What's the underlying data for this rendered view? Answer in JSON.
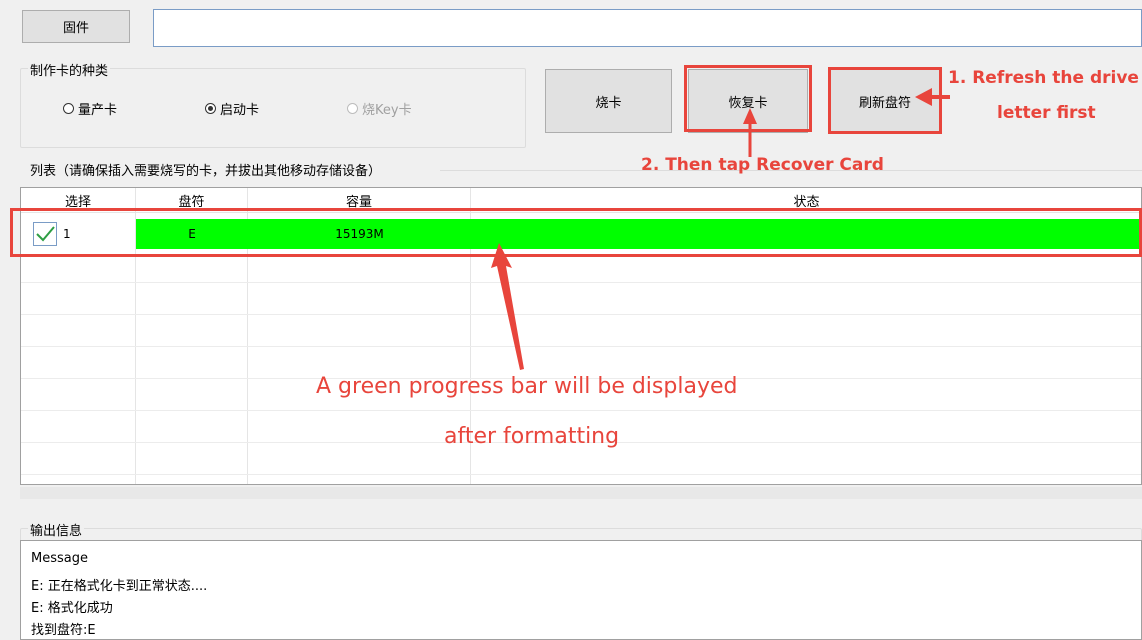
{
  "toolbar": {
    "firmware_label": "固件",
    "firmware_path": ""
  },
  "card_type": {
    "legend": "制作卡的种类",
    "options": [
      {
        "label": "量产卡",
        "selected": false,
        "disabled": false
      },
      {
        "label": "启动卡",
        "selected": true,
        "disabled": false
      },
      {
        "label": "烧Key卡",
        "selected": false,
        "disabled": true
      }
    ]
  },
  "actions": {
    "burn_label": "烧卡",
    "recover_label": "恢复卡",
    "refresh_label": "刷新盘符"
  },
  "list": {
    "legend": "列表（请确保插入需要烧写的卡，并拔出其他移动存储设备）",
    "columns": [
      "选择",
      "盘符",
      "容量",
      "状态"
    ],
    "rows": [
      {
        "index": "1",
        "checked": true,
        "drive": "E",
        "capacity": "15193M",
        "status": "",
        "progress": 1.0
      }
    ]
  },
  "output": {
    "legend": "输出信息",
    "lines": [
      "Message",
      "E: 正在格式化卡到正常状态....",
      "E: 格式化成功",
      "找到盘符:E"
    ]
  },
  "annotations": {
    "step1_line1": "1. Refresh the drive",
    "step1_line2": "letter first",
    "step2": "2. Then tap Recover Card",
    "note_line1": "A green progress bar will be displayed",
    "note_line2": "after formatting"
  },
  "colors": {
    "progress": "#00ff00",
    "annotation": "#e8453c"
  }
}
